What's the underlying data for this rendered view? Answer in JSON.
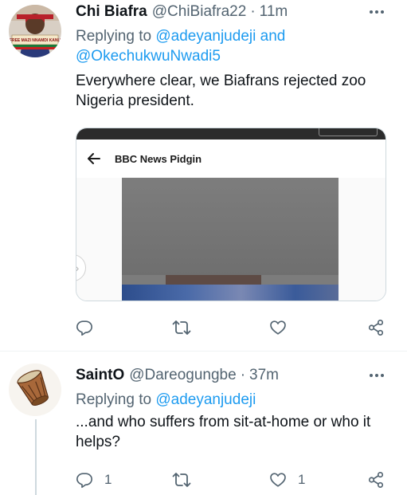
{
  "tweets": [
    {
      "name": "Chi Biafra",
      "handle": "@ChiBiafra22",
      "separator": "·",
      "time": "11m",
      "replying_prefix": "Replying to",
      "mentions": [
        "@adeyanjudeji",
        "@OkechukwuNwadi5"
      ],
      "mention_joiner": "and",
      "text": "Everywhere clear, we Biafrans rejected zoo Nigeria president.",
      "avatar_banner_text": "FREE MAZI NNAMDI KANU",
      "media": {
        "app_title": "BBC News Pidgin"
      },
      "actions": {
        "reply_count": "",
        "retweet_count": "",
        "like_count": ""
      }
    },
    {
      "name": "SaintO",
      "handle": "@Dareogungbe",
      "separator": "·",
      "time": "37m",
      "replying_prefix": "Replying to",
      "mentions": [
        "@adeyanjudeji"
      ],
      "text": "...and who suffers from sit-at-home or who it helps?",
      "actions": {
        "reply_count": "1",
        "retweet_count": "",
        "like_count": "1"
      }
    }
  ],
  "colors": {
    "link": "#1d9bf0",
    "secondary_text": "#536471",
    "primary_text": "#0f1419",
    "divider": "#eff3f4"
  },
  "icons": {
    "more": "more-dots-icon",
    "reply": "reply-bubble-icon",
    "retweet": "retweet-arrows-icon",
    "like": "heart-icon",
    "share": "share-icon",
    "back": "arrow-left-icon"
  }
}
